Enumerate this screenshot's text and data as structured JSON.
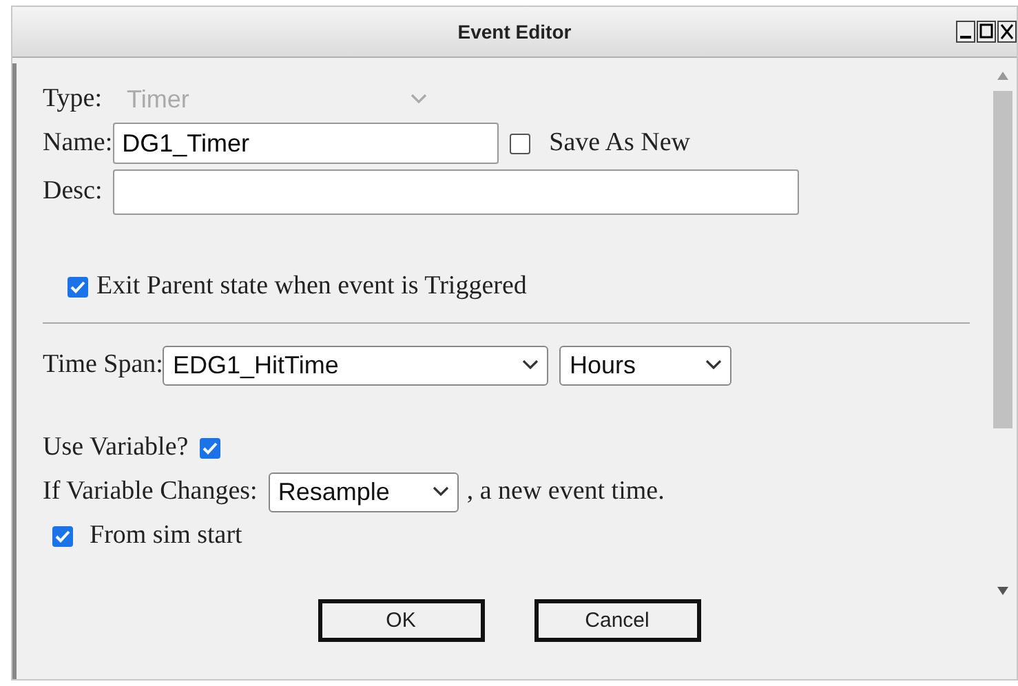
{
  "window": {
    "title": "Event Editor"
  },
  "type": {
    "label": "Type:",
    "value": "Timer",
    "disabled": true
  },
  "name": {
    "label": "Name:",
    "value": "DG1_Timer"
  },
  "save_as_new": {
    "label": "Save As New",
    "checked": false
  },
  "desc": {
    "label": "Desc:"
  },
  "exit_parent": {
    "label": "Exit Parent state when event is Triggered",
    "checked": true
  },
  "time_span": {
    "label": "Time Span:",
    "variable": "EDG1_HitTime",
    "unit": "Hours"
  },
  "use_variable": {
    "label": "Use Variable?",
    "checked": true
  },
  "if_changes": {
    "label": "If Variable Changes:",
    "value": "Resample",
    "suffix": ", a new event time."
  },
  "from_sim_start": {
    "label": "From sim start",
    "checked": true
  },
  "buttons": [
    "OK",
    "Cancel"
  ]
}
